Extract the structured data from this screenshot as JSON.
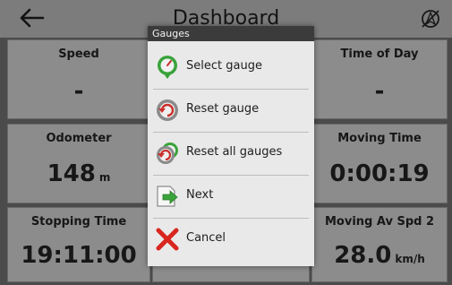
{
  "header": {
    "title": "Dashboard"
  },
  "tiles": [
    {
      "label": "Speed",
      "value": "-",
      "unit": ""
    },
    {
      "label": "Time of Day",
      "value": "-",
      "unit": ""
    },
    {
      "label": "Odometer",
      "value": "148",
      "unit": "m"
    },
    {
      "label": "Moving Time",
      "value": "0:00:19",
      "unit": ""
    },
    {
      "label": "Stopping Time",
      "value": "19:11:00",
      "unit": ""
    },
    {
      "label": "Moving Av Spd 2",
      "value": "28.0",
      "unit": "km/h"
    }
  ],
  "dialog": {
    "title": "Gauges",
    "items": [
      {
        "label": "Select gauge",
        "icon": "gauge-select-icon"
      },
      {
        "label": "Reset gauge",
        "icon": "gauge-reset-icon"
      },
      {
        "label": "Reset all gauges",
        "icon": "gauges-reset-all-icon"
      },
      {
        "label": "Next",
        "icon": "next-arrow-icon"
      },
      {
        "label": "Cancel",
        "icon": "cancel-x-icon"
      }
    ]
  },
  "colors": {
    "accent_green": "#3aa33a",
    "cancel_red": "#d8261f",
    "reset_red": "#c9302c"
  }
}
